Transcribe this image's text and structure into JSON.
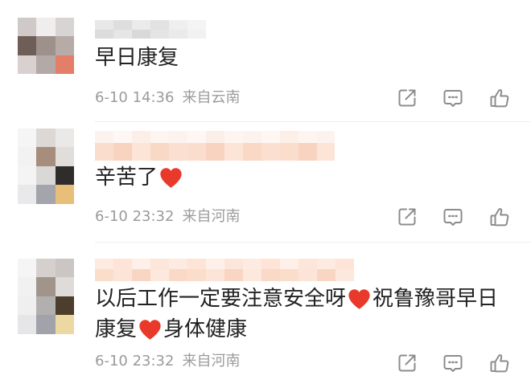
{
  "theme": {
    "background": "#ffffff",
    "text": "#222222",
    "meta": "#9b9b9b",
    "icon": "#8c8c8c",
    "heart": "#e8392b",
    "divider": "#efefef"
  },
  "comments": [
    {
      "lines": [
        [
          {
            "text": "早日康复"
          }
        ]
      ],
      "time": "6-10 14:36",
      "source": "来自云南",
      "actions": [
        "forward-icon",
        "comment-icon",
        "like-icon"
      ]
    },
    {
      "lines": [
        [
          {
            "text": "辛苦了"
          },
          {
            "emoji": "red-heart"
          }
        ]
      ],
      "time": "6-10 23:32",
      "source": "来自河南",
      "actions": [
        "forward-icon",
        "comment-icon",
        "like-icon"
      ]
    },
    {
      "lines": [
        [
          {
            "text": "以后工作一定要注意安全呀"
          },
          {
            "emoji": "red-heart"
          },
          {
            "text": "祝鲁豫哥早日"
          }
        ],
        [
          {
            "text": "康复"
          },
          {
            "emoji": "red-heart"
          },
          {
            "text": "身体健康"
          }
        ]
      ],
      "time": "6-10 23:32",
      "source": "来自河南",
      "actions": [
        "forward-icon",
        "comment-icon",
        "like-icon"
      ]
    }
  ]
}
